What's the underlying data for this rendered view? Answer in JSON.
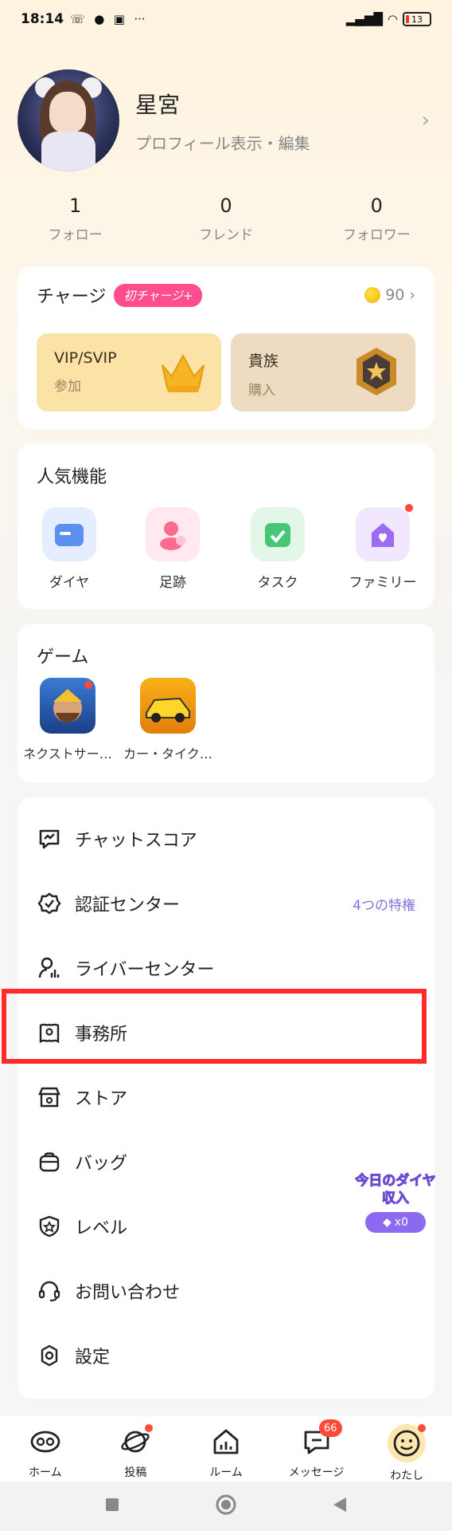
{
  "status_bar": {
    "time": "18:14",
    "battery": "13",
    "more": "···"
  },
  "profile": {
    "name": "星宮",
    "subtitle": "プロフィール表示・編集",
    "chevron": "›"
  },
  "counts": [
    {
      "value": "1",
      "label": "フォロー"
    },
    {
      "value": "0",
      "label": "フレンド"
    },
    {
      "value": "0",
      "label": "フォロワー"
    }
  ],
  "charge": {
    "title": "チャージ",
    "badge": "初チャージ+",
    "coins": "90",
    "chevron": "›",
    "tiles": [
      {
        "title": "VIP/SVIP",
        "subtitle": "参加"
      },
      {
        "title": "貴族",
        "subtitle": "購入"
      }
    ]
  },
  "popular": {
    "title": "人気機能",
    "items": [
      {
        "label": "ダイヤ",
        "icon": "wallet-icon",
        "color": "#5b8ff0"
      },
      {
        "label": "足跡",
        "icon": "footprint-icon",
        "color": "#ff6a8f"
      },
      {
        "label": "タスク",
        "icon": "calendar-check-icon",
        "color": "#46c776"
      },
      {
        "label": "ファミリー",
        "icon": "family-house-icon",
        "color": "#9b6cf0"
      }
    ]
  },
  "games": {
    "title": "ゲーム",
    "items": [
      {
        "label": "ネクストサー…"
      },
      {
        "label": "カー・タイク…"
      }
    ]
  },
  "menu": {
    "items": [
      {
        "label": "チャットスコア",
        "icon": "chat-score-icon"
      },
      {
        "label": "認証センター",
        "icon": "verified-badge-icon",
        "extra": "4つの特権"
      },
      {
        "label": "ライバーセンター",
        "icon": "streamer-icon"
      },
      {
        "label": "事務所",
        "icon": "agency-icon"
      },
      {
        "label": "ストア",
        "icon": "store-icon"
      },
      {
        "label": "バッグ",
        "icon": "bag-icon"
      },
      {
        "label": "レベル",
        "icon": "level-shield-icon"
      },
      {
        "label": "お問い合わせ",
        "icon": "headset-icon"
      },
      {
        "label": "設定",
        "icon": "settings-gear-icon"
      }
    ]
  },
  "promo": {
    "text": "今日のダイヤ収入",
    "value": "x0"
  },
  "tabs": [
    {
      "label": "ホーム",
      "icon": "home-icon"
    },
    {
      "label": "投稿",
      "icon": "planet-icon"
    },
    {
      "label": "ルーム",
      "icon": "room-icon"
    },
    {
      "label": "メッセージ",
      "icon": "message-icon",
      "badge": "66"
    },
    {
      "label": "わたし",
      "icon": "me-face-icon"
    }
  ],
  "colors": {
    "accent_pink": "#ff4d8f",
    "highlight_red": "#ff2a2a",
    "purple": "#7e72e0"
  }
}
